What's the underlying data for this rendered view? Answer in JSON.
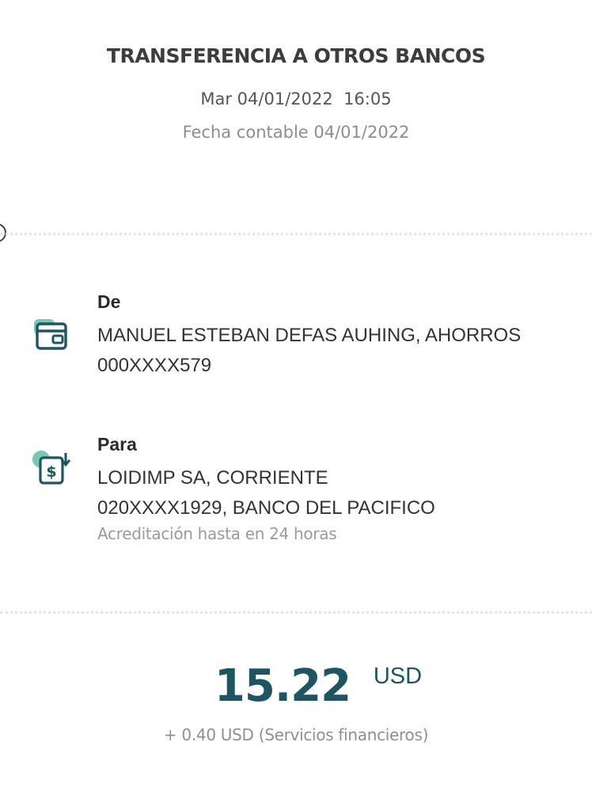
{
  "header": {
    "title": "TRANSFERENCIA A OTROS BANCOS",
    "date_time": "Mar 04/01/2022  16:05",
    "accounting_date": "Fecha contable 04/01/2022"
  },
  "from": {
    "label": "De",
    "icon": "wallet-icon",
    "line1": "MANUEL ESTEBAN DEFAS AUHING, AHORROS",
    "line2": "000XXXX579"
  },
  "to": {
    "label": "Para",
    "icon": "bank-transfer-icon",
    "line1": "LOIDIMP SA, CORRIENTE",
    "line2": "020XXXX1929, BANCO DEL PACIFICO",
    "note": "Acreditación hasta en 24 horas"
  },
  "amount": {
    "value": "15.22",
    "currency": "USD",
    "fee": "+ 0.40 USD (Servicios financieros)"
  },
  "colors": {
    "accent": "#1f5560",
    "icon_light": "#5fbfa8"
  }
}
